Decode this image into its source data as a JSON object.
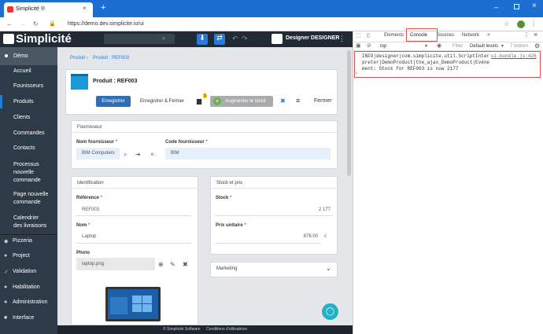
{
  "browser": {
    "tab_title": "Simplicité ®",
    "url": "https://demo.dev.simplicite.io/ui"
  },
  "app": {
    "logo": "Simplicité",
    "user": "Designer DESIGNER"
  },
  "sidebar": {
    "group": "Démo",
    "items": [
      "Accueil",
      "Founisseurs",
      "Produits",
      "Clients",
      "Commandes",
      "Contacts",
      "Processus nouvelle commande",
      "Page nouvelle commande",
      "Calendrier des livraisons"
    ],
    "modules": [
      "Pizzeria",
      "Project",
      "Validation",
      "Habilitation",
      "Administration",
      "Interface"
    ]
  },
  "breadcrumb": {
    "root": "Produit",
    "current": "Produit : REF003"
  },
  "form": {
    "title": "Produit : REF003",
    "save": "Enregistrer",
    "save_close": "Enregistrer & Fermer",
    "badge": "1",
    "increase_stock": "Augmenter le stock",
    "close": "Fermer"
  },
  "supplier": {
    "title": "Fournisseur",
    "name_label": "Nom fournisseur",
    "name_value": "BIM Computers",
    "code_label": "Code fournisseur",
    "code_value": "BIM"
  },
  "ident": {
    "title": "Identification",
    "ref_label": "Référence",
    "ref_value": "REF003",
    "name_label": "Nom",
    "name_value": "Laptop",
    "photo_label": "Photo",
    "photo_value": "laptop.png"
  },
  "stock": {
    "title": "Stock et prix",
    "stock_label": "Stock",
    "stock_value": "2 177",
    "price_label": "Prix unitaire",
    "price_value": "876,00",
    "currency": "€"
  },
  "marketing": {
    "title": "Marketing"
  },
  "footer": {
    "copyright": "© Simplicité Software",
    "terms": "Conditions d'utilisations"
  },
  "devtools": {
    "tabs": [
      "Elements",
      "Console",
      "Sources",
      "Network"
    ],
    "context": "top",
    "filter": "Filter",
    "levels": "Default levels",
    "hidden": "7 hidden",
    "log_text": "INFO|designer|com.simplicite.util.ScriptInterpreter|DemoProduct|the_ajax_DemoProduct|Evénement: Stock for REF003 is now 2177",
    "log_source": "ui-bundle.js:426"
  }
}
